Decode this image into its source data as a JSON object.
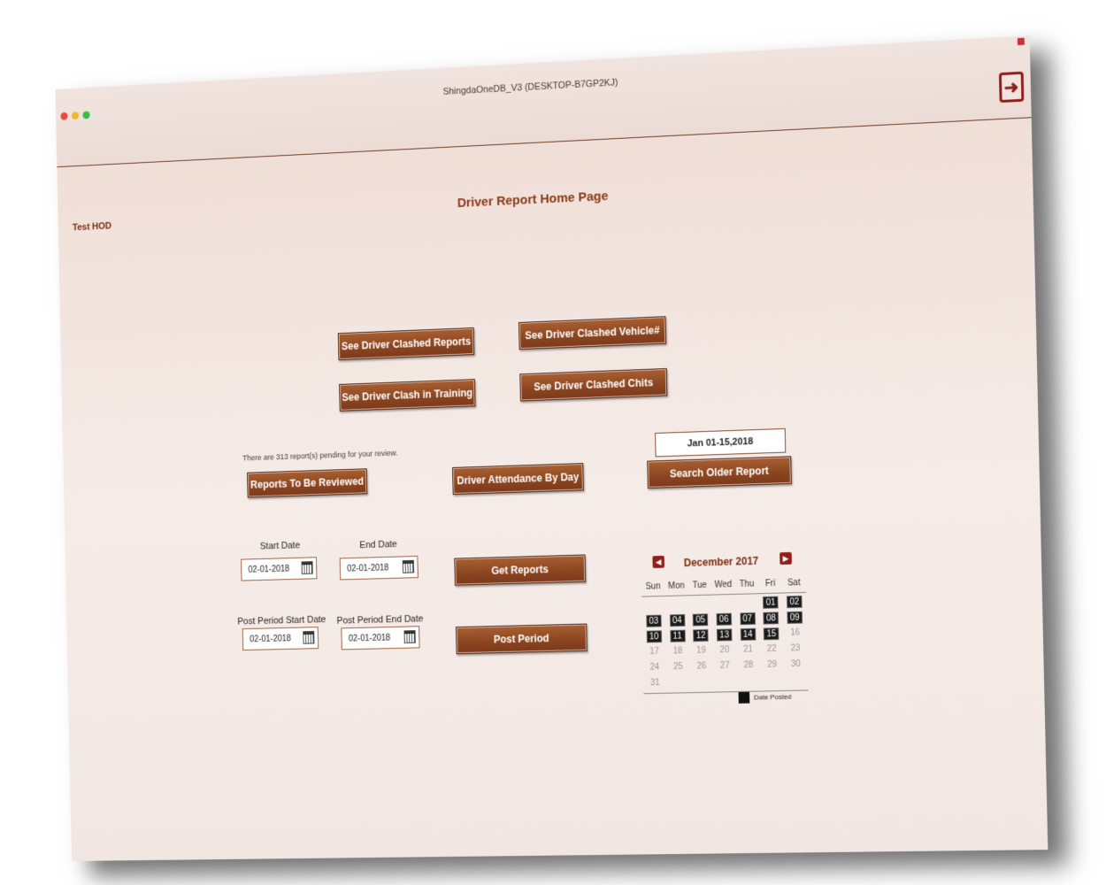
{
  "window": {
    "title": "ShingdaOneDB_V3 (DESKTOP-B7GP2KJ)"
  },
  "header": {
    "user": "Test HOD",
    "page_title": "Driver Report Home Page"
  },
  "buttons": {
    "clashed_reports": "See Driver Clashed Reports",
    "clashed_vehicle": "See Driver Clashed Vehicle#",
    "clash_training": "See Driver Clash in Training",
    "clashed_chits": "See Driver Clashed Chits",
    "reports_review": "Reports To Be Reviewed",
    "attendance": "Driver Attendance By Day",
    "search_older": "Search Older Report",
    "get_reports": "Get Reports",
    "post_period": "Post Period"
  },
  "pending_text": "There are 313 report(s) pending for your review.",
  "older_report_range": "Jan 01-15,2018",
  "dates": {
    "start_label": "Start Date",
    "end_label": "End Date",
    "post_start_label": "Post Period Start Date",
    "post_end_label": "Post Period End Date",
    "start_value": "02-01-2018",
    "end_value": "02-01-2018",
    "post_start_value": "02-01-2018",
    "post_end_value": "02-01-2018"
  },
  "calendar": {
    "month": "December 2017",
    "weekdays": [
      "Sun",
      "Mon",
      "Tue",
      "Wed",
      "Thu",
      "Fri",
      "Sat"
    ],
    "weeks": [
      [
        "",
        "",
        "",
        "",
        "",
        "01",
        "02"
      ],
      [
        "03",
        "04",
        "05",
        "06",
        "07",
        "08",
        "09"
      ],
      [
        "10",
        "11",
        "12",
        "13",
        "14",
        "15",
        "16"
      ],
      [
        "17",
        "18",
        "19",
        "20",
        "21",
        "22",
        "23"
      ],
      [
        "24",
        "25",
        "26",
        "27",
        "28",
        "29",
        "30"
      ],
      [
        "31",
        "",
        "",
        "",
        "",
        "",
        ""
      ]
    ],
    "posted": [
      "01",
      "02",
      "03",
      "04",
      "05",
      "06",
      "07",
      "08",
      "09",
      "10",
      "11",
      "12",
      "13",
      "14",
      "15"
    ],
    "legend": "Date Posted"
  },
  "colors": {
    "button": "#8a4420",
    "accent": "#8f1d18",
    "posted": "#1a1a1a"
  }
}
